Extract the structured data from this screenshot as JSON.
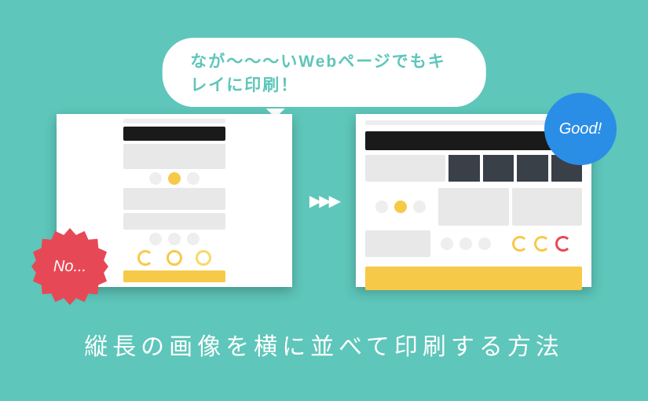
{
  "bubble_text": "なが〜〜〜いWebページでもキレイに印刷！",
  "badge_no": "No...",
  "badge_good": "Good!",
  "main_title": "縦長の画像を横に並べて印刷する方法"
}
